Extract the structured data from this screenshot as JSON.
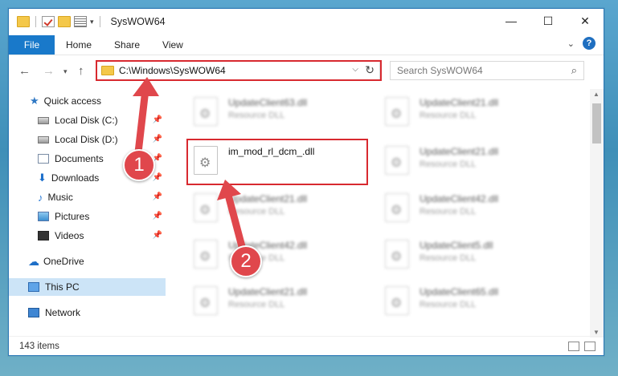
{
  "window": {
    "title": "SysWOW64",
    "min_glyph": "—",
    "max_glyph": "☐",
    "close_glyph": "✕"
  },
  "ribbon": {
    "tabs": [
      "File",
      "Home",
      "Share",
      "View"
    ],
    "help": "?"
  },
  "address": {
    "path": "C:\\Windows\\SysWOW64",
    "search_placeholder": "Search SysWOW64"
  },
  "nav": {
    "items": [
      {
        "label": "Quick access",
        "pinned": false
      },
      {
        "label": "Local Disk (C:)",
        "pinned": true
      },
      {
        "label": "Local Disk (D:)",
        "pinned": true
      },
      {
        "label": "Documents",
        "pinned": true
      },
      {
        "label": "Downloads",
        "pinned": true
      },
      {
        "label": "Music",
        "pinned": true
      },
      {
        "label": "Pictures",
        "pinned": true
      },
      {
        "label": "Videos",
        "pinned": true
      },
      {
        "label": "OneDrive",
        "pinned": false
      },
      {
        "label": "This PC",
        "pinned": false,
        "selected": true
      },
      {
        "label": "Network",
        "pinned": false
      }
    ]
  },
  "files": {
    "left": [
      {
        "name": "UpdateClient63.dll",
        "type": "Resource DLL"
      },
      {
        "name": "im_mod_rl_dcm_.dll",
        "type": ""
      },
      {
        "name": "UpdateClient21.dll",
        "type": "Resource DLL"
      },
      {
        "name": "UpdateClient42.dll",
        "type": "Resource DLL"
      },
      {
        "name": "UpdateClient21.dll",
        "type": "Resource DLL"
      }
    ],
    "right": [
      {
        "name": "UpdateClient21.dll",
        "type": "Resource DLL"
      },
      {
        "name": "UpdateClient21.dll",
        "type": "Resource DLL"
      },
      {
        "name": "UpdateClient42.dll",
        "type": "Resource DLL"
      },
      {
        "name": "UpdateClient5.dll",
        "type": "Resource DLL"
      },
      {
        "name": "UpdateClient65.dll",
        "type": "Resource DLL"
      }
    ]
  },
  "status": {
    "item_count": "143 items"
  },
  "callouts": {
    "one": "1",
    "two": "2"
  },
  "colors": {
    "accent": "#1979ca",
    "highlight": "#d8292f",
    "callout": "#e0474c"
  }
}
